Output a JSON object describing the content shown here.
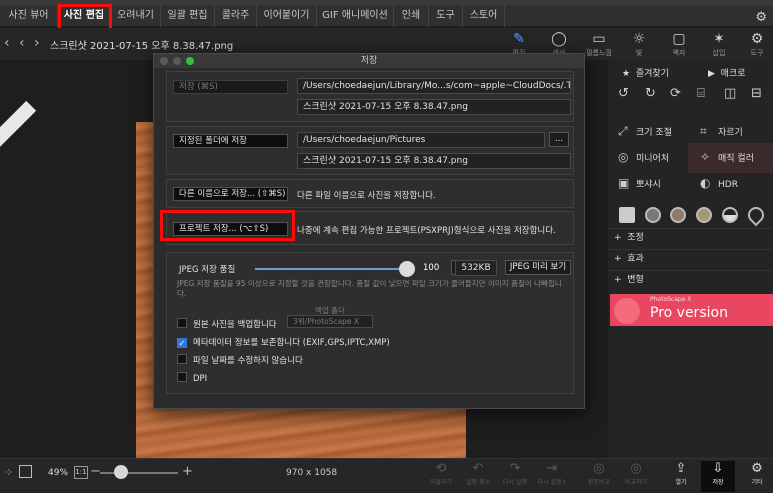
{
  "app": {
    "title": "PhotoScape X"
  },
  "top_tabs": [
    "사진 뷰어",
    "사진 편집",
    "오려내기",
    "일괄 편집",
    "콜라주",
    "이어붙이기",
    "GIF 애니메이션",
    "인쇄",
    "도구",
    "스토어"
  ],
  "active_tab": "사진 편집",
  "toolbar": {
    "filename": "스크린샷 2021-07-15 오후 8.38.47.png",
    "tools": [
      {
        "icon": "pencil-square-icon",
        "label": "편집"
      },
      {
        "icon": "circle-icon",
        "label": "색상"
      },
      {
        "icon": "film-filter-icon",
        "label": "필름느낌"
      },
      {
        "icon": "sun-icon",
        "label": "빛"
      },
      {
        "icon": "frame-icon",
        "label": "액자"
      },
      {
        "icon": "insert-icon",
        "label": "삽입"
      },
      {
        "icon": "tools-icon",
        "label": "도구"
      }
    ]
  },
  "right_panel": {
    "favorites_tab": "즐겨찾기",
    "macro_tab": "매크로",
    "tools": [
      {
        "label": "크기 조절",
        "icon": "resize-icon"
      },
      {
        "label": "자르기",
        "icon": "crop-icon"
      },
      {
        "label": "미니어처",
        "icon": "miniature-icon"
      },
      {
        "label": "매직 컬러",
        "icon": "magic-wand-icon"
      },
      {
        "label": "뽀샤시",
        "icon": "bloom-icon"
      },
      {
        "label": "HDR",
        "icon": "hdr-icon"
      }
    ],
    "sections": [
      "조정",
      "효과",
      "변형"
    ],
    "banner": {
      "small": "PhotoScape X",
      "big": "Pro version"
    }
  },
  "dialog": {
    "title": "저장",
    "group1": {
      "button": "저장   (⌘S)",
      "path": "/Users/choedaejun/Library/Mo...s/com~apple~CloudDocs/.Trash",
      "filename": "스크린샷 2021-07-15 오후 8.38.47.png"
    },
    "group2": {
      "button": "지정된 폴더에 저장",
      "path": "/Users/choedaejun/Pictures",
      "browse": "...",
      "filename": "스크린샷 2021-07-15 오후 8.38.47.png"
    },
    "save_as": {
      "button": "다른 이름으로 저장...   (⇧⌘S)",
      "desc": "다른 파일 이름으로 사진을 저장합니다."
    },
    "project": {
      "button": "프로젝트 저장...   (⌥⇧S)",
      "desc": "나중에 계속 편집 가능한 프로젝트(PSXPRJ)형식으로 사진을 저장합니다."
    },
    "jpeg": {
      "label": "JPEG 저장 품질",
      "quality": "100",
      "size": "532KB",
      "preview_button": "JPEG 미리 보기",
      "info": "JPEG 저장 품질을 95 이상으로 지정할 것을 권장합니다. 품질 값이 낮으면 파일 크기가 줄어들지만 이미지 품질이 나빠집니다.",
      "backup_folder_label": "백업 폴더",
      "backup_folder_value": "3위/PhotoScape X"
    },
    "checkboxes": [
      {
        "label": "원본 사진을 백업합니다",
        "checked": false
      },
      {
        "label": "메타데이터 정보를 보존합니다 (EXIF,GPS,IPTC,XMP)",
        "checked": true
      },
      {
        "label": "파일 날짜를 수정하지 않습니다",
        "checked": false
      },
      {
        "label": "DPI",
        "checked": false
      }
    ]
  },
  "bottom_bar": {
    "zoom": "49%",
    "one_to_one": "1:1",
    "dimensions": "970 x 1058",
    "buttons": [
      {
        "label": "되돌리기",
        "icon": "revert-icon",
        "enabled": false
      },
      {
        "label": "실행 취소",
        "icon": "undo-icon",
        "enabled": false
      },
      {
        "label": "다시 실행",
        "icon": "redo-icon",
        "enabled": false
      },
      {
        "label": "다시 실행+",
        "icon": "redo-all-icon",
        "enabled": false
      },
      {
        "label": "원본비교",
        "icon": "compare-original-icon",
        "enabled": false
      },
      {
        "label": "비교하기",
        "icon": "compare-icon",
        "enabled": false
      },
      {
        "label": "열기",
        "icon": "open-icon",
        "enabled": true
      },
      {
        "label": "저장",
        "icon": "save-icon",
        "enabled": true
      },
      {
        "label": "기타",
        "icon": "more-icon",
        "enabled": true
      }
    ]
  },
  "colors": {
    "highlight": "#ff0a0a",
    "checkbox_accent": "#2f76d6",
    "banner": "#e8475f"
  }
}
